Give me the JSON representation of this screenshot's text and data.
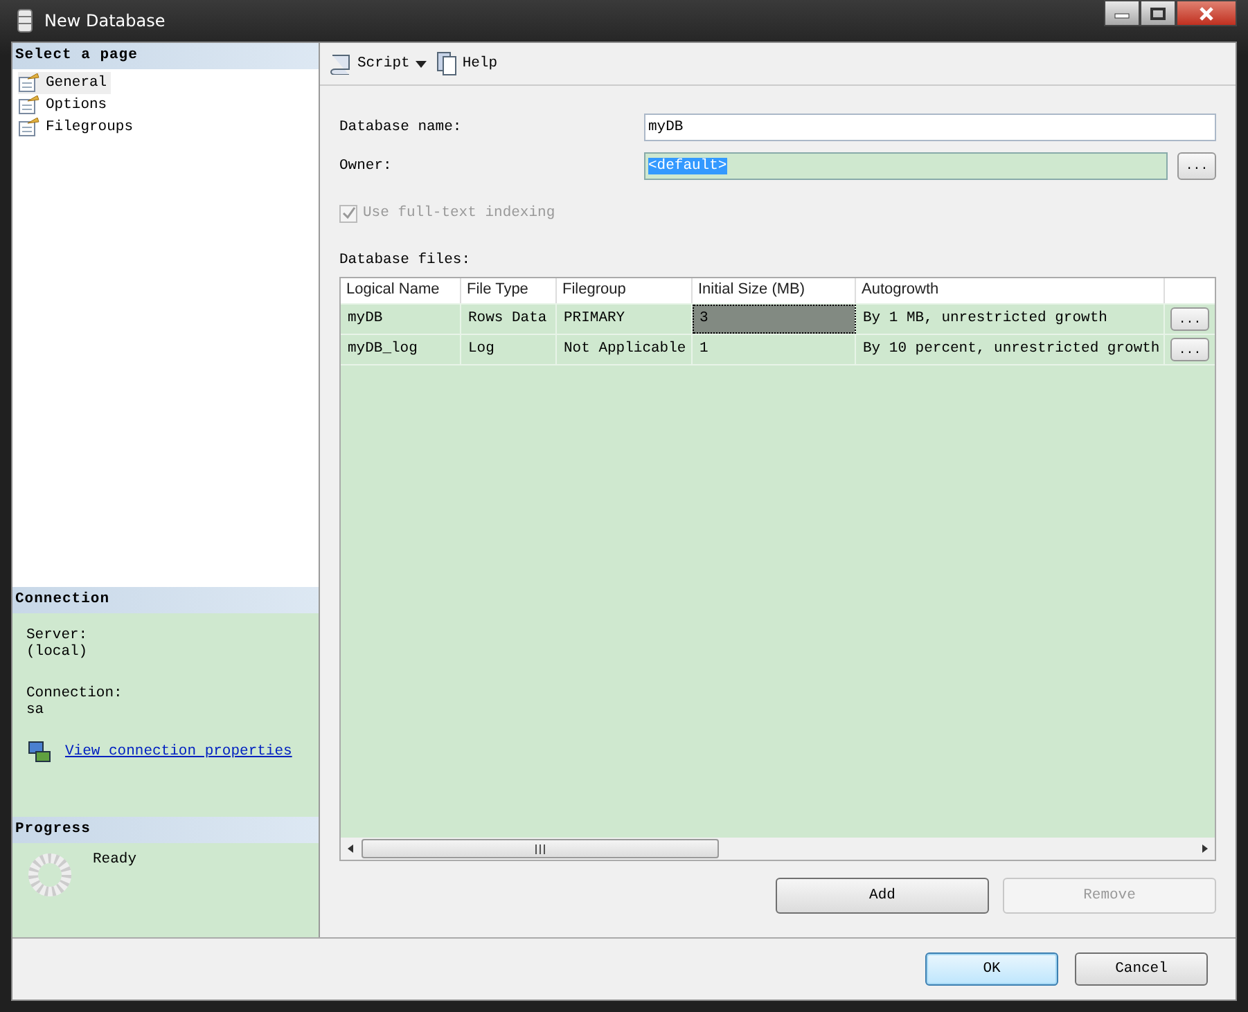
{
  "window": {
    "title": "New Database"
  },
  "sidebar": {
    "header": "Select a page",
    "pages": [
      {
        "label": "General",
        "selected": true
      },
      {
        "label": "Options",
        "selected": false
      },
      {
        "label": "Filegroups",
        "selected": false
      }
    ]
  },
  "connection": {
    "header": "Connection",
    "server_label": "Server:",
    "server": "(local)",
    "connection_label": "Connection:",
    "connection": "sa",
    "link": "View connection properties"
  },
  "progress": {
    "header": "Progress",
    "status": "Ready"
  },
  "toolbar": [
    {
      "label": "Script",
      "kind": "dropdown"
    },
    {
      "label": "Help",
      "kind": "button"
    }
  ],
  "form": {
    "database_name": {
      "label": "Database name:",
      "value": "myDB"
    },
    "owner": {
      "label": "Owner:",
      "value": "<default>",
      "selected": true,
      "button": "..."
    },
    "full_text": {
      "label": "Use full-text indexing",
      "checked": true,
      "disabled": true
    }
  },
  "files": {
    "label": "Database files:",
    "columns": [
      "Logical Name",
      "File Type",
      "Filegroup",
      "Initial Size (MB)",
      "Autogrowth"
    ],
    "rows": [
      {
        "cells": [
          {
            "text": "myDB",
            "selected": false
          },
          {
            "text": "Rows Data",
            "selected": false
          },
          {
            "text": "PRIMARY",
            "selected": false
          },
          {
            "text": "3",
            "selected": true
          },
          {
            "text": "By 1 MB, unrestricted growth",
            "selected": false
          }
        ],
        "button": "..."
      },
      {
        "cells": [
          {
            "text": "myDB_log",
            "selected": false
          },
          {
            "text": "Log",
            "selected": false
          },
          {
            "text": "Not Applicable",
            "selected": false
          },
          {
            "text": "1",
            "selected": false
          },
          {
            "text": "By 10 percent, unrestricted growth",
            "selected": false
          }
        ],
        "button": "..."
      }
    ]
  },
  "file_buttons": [
    {
      "label": "Add",
      "disabled": false
    },
    {
      "label": "Remove",
      "disabled": true
    }
  ],
  "dialog_buttons": [
    {
      "label": "OK",
      "default": true
    },
    {
      "label": "Cancel",
      "default": false
    }
  ]
}
